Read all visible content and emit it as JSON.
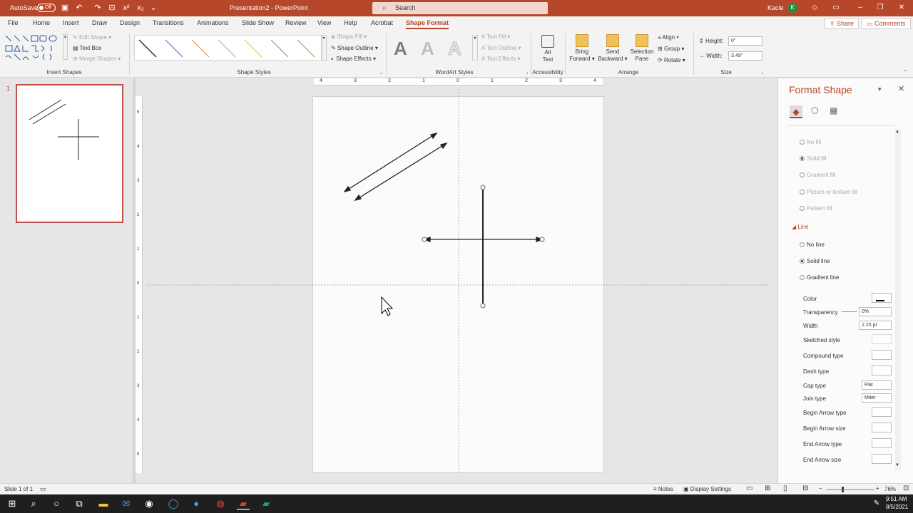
{
  "titlebar": {
    "autosave_label": "AutoSave",
    "autosave_state": "Off",
    "doc_title": "Presentation2  -  PowerPoint",
    "search_placeholder": "Search",
    "user_name": "Kacie",
    "user_initial": "K"
  },
  "menu": {
    "tabs": [
      "File",
      "Home",
      "Insert",
      "Draw",
      "Design",
      "Transitions",
      "Animations",
      "Slide Show",
      "Review",
      "View",
      "Help",
      "Acrobat",
      "Shape Format"
    ],
    "active_tab": "Shape Format",
    "share": "Share",
    "comments": "Comments"
  },
  "ribbon": {
    "insert_shapes": {
      "label": "Insert Shapes",
      "edit_shape": "Edit Shape",
      "text_box": "Text Box",
      "merge_shapes": "Merge Shapes"
    },
    "shape_styles": {
      "label": "Shape Styles",
      "shape_fill": "Shape Fill",
      "shape_outline": "Shape Outline",
      "shape_effects": "Shape Effects",
      "swatch_colors": [
        "#333333",
        "#4472c4",
        "#ed7d31",
        "#a5a5a5",
        "#ffc000",
        "#5b9bd5",
        "#70ad47"
      ]
    },
    "wordart": {
      "label": "WordArt Styles",
      "text_fill": "Text Fill",
      "text_outline": "Text Outline",
      "text_effects": "Text Effects",
      "glyph": "A"
    },
    "accessibility": {
      "label": "Accessibility",
      "alt_text_1": "Alt",
      "alt_text_2": "Text"
    },
    "arrange": {
      "label": "Arrange",
      "bring_forward_1": "Bring",
      "bring_forward_2": "Forward",
      "send_backward_1": "Send",
      "send_backward_2": "Backward",
      "selection_pane_1": "Selection",
      "selection_pane_2": "Pane",
      "align": "Align",
      "group": "Group",
      "rotate": "Rotate"
    },
    "size": {
      "label": "Size",
      "height_label": "Height:",
      "height_value": "0\"",
      "width_label": "Width:",
      "width_value": "3.49\""
    }
  },
  "thumbnail": {
    "number": "1"
  },
  "rulers": {
    "horizontal": [
      "4",
      "3",
      "2",
      "1",
      "0",
      "1",
      "2",
      "3",
      "4"
    ],
    "vertical": [
      "5",
      "4",
      "3",
      "2",
      "1",
      "0",
      "1",
      "2",
      "3",
      "4",
      "5"
    ]
  },
  "format_pane": {
    "title": "Format Shape",
    "fill_options": [
      "No fill",
      "Solid fill",
      "Gradient fill",
      "Picture or texture fill",
      "Pattern fill"
    ],
    "line_header": "Line",
    "line_options": [
      "No line",
      "Solid line",
      "Gradient line"
    ],
    "props": {
      "color": "Color",
      "transparency": "Transparency",
      "transparency_value": "0%",
      "width": "Width",
      "width_value": "2.25 pt",
      "sketched": "Sketched style",
      "compound": "Compound type",
      "dash": "Dash type",
      "cap": "Cap type",
      "cap_value": "Flat",
      "join": "Join type",
      "join_value": "Miter",
      "begin_arrow_type": "Begin Arrow type",
      "begin_arrow_size": "Begin Arrow size",
      "end_arrow_type": "End Arrow type",
      "end_arrow_size": "End Arrow size"
    }
  },
  "status": {
    "slide_info": "Slide 1 of 1",
    "notes": "Notes",
    "display_settings": "Display Settings",
    "zoom": "76%"
  },
  "taskbar": {
    "time": "9:51 AM",
    "date": "8/5/2021"
  },
  "colors": {
    "accent": "#b7472a",
    "ribbon_bg": "#f3f3f3",
    "taskbar": "#1f1f1f"
  }
}
